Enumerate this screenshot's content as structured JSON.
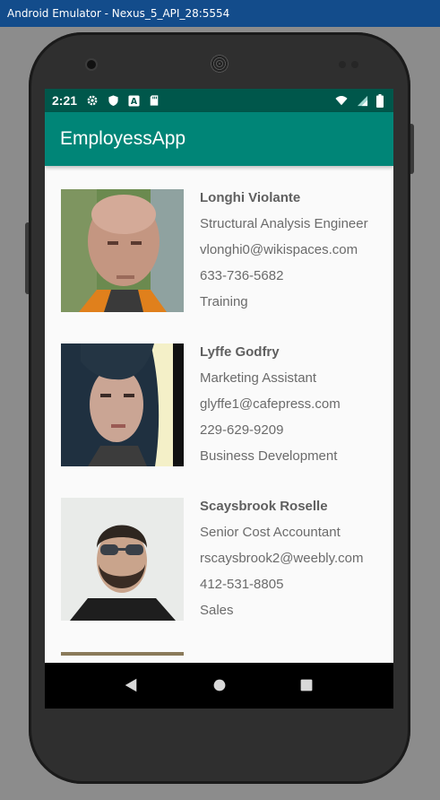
{
  "window": {
    "title": "Android Emulator - Nexus_5_API_28:5554"
  },
  "status_bar": {
    "time": "2:21",
    "left_icons": [
      "gear-icon",
      "shield-icon",
      "a-icon",
      "sd-card-icon"
    ],
    "right_icons": [
      "wifi-icon",
      "signal-icon",
      "battery-icon"
    ]
  },
  "app_bar": {
    "title": "EmployessApp"
  },
  "employees": [
    {
      "name": "Longhi Violante",
      "title": "Structural Analysis Engineer",
      "email": "vlonghi0@wikispaces.com",
      "phone": "633-736-5682",
      "department": "Training"
    },
    {
      "name": "Lyffe Godfry",
      "title": "Marketing Assistant",
      "email": "glyffe1@cafepress.com",
      "phone": "229-629-9209",
      "department": "Business Development"
    },
    {
      "name": "Scaysbrook Roselle",
      "title": "Senior Cost Accountant",
      "email": "rscaysbrook2@weebly.com",
      "phone": "412-531-8805",
      "department": "Sales"
    }
  ],
  "nav_bar": {
    "icons": [
      "back-icon",
      "home-icon",
      "recents-icon"
    ]
  },
  "colors": {
    "status_bar": "#00574b",
    "app_bar": "#008577",
    "background": "#fafafa",
    "text": "#6b6b6b"
  }
}
